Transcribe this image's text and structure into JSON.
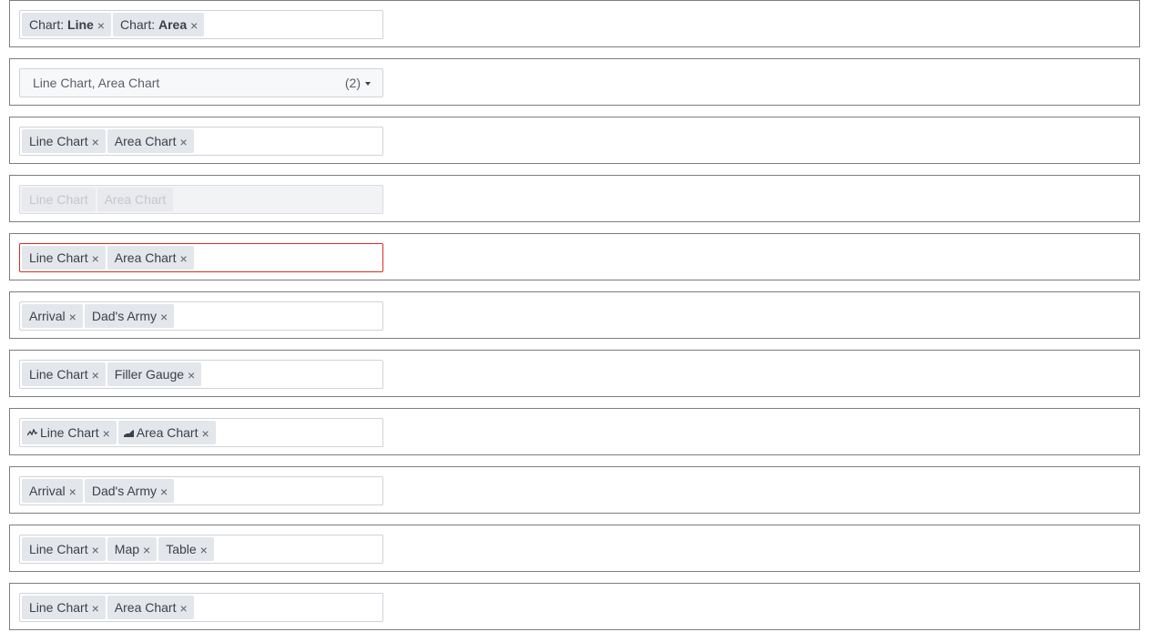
{
  "rows": [
    {
      "chips": [
        {
          "prefix": "Chart: ",
          "strong": "Line"
        },
        {
          "prefix": "Chart: ",
          "strong": "Area"
        }
      ]
    },
    {
      "dropdown": {
        "value": "Line Chart, Area Chart",
        "count": "(2)"
      }
    },
    {
      "chips": [
        "Line Chart",
        "Area Chart"
      ]
    },
    {
      "chips": [
        "Line Chart",
        "Area Chart"
      ],
      "state": "disabled"
    },
    {
      "chips": [
        "Line Chart",
        "Area Chart"
      ],
      "state": "error"
    },
    {
      "chips": [
        "Arrival",
        "Dad's Army"
      ]
    },
    {
      "chips": [
        "Line Chart",
        "Filler Gauge"
      ]
    },
    {
      "chips": [
        {
          "label": "Line Chart",
          "icon": "line-chart-icon"
        },
        {
          "label": "Area Chart",
          "icon": "area-chart-icon"
        }
      ]
    },
    {
      "chips": [
        "Arrival",
        "Dad's Army"
      ]
    },
    {
      "chips": [
        "Line Chart",
        "Map",
        "Table"
      ]
    },
    {
      "chips": [
        "Line Chart",
        "Area Chart"
      ]
    }
  ],
  "remove_glyph": "×",
  "colors": {
    "error_border": "#d5301f",
    "chip_bg": "#e3e6ea",
    "row_border": "#7d7d7d"
  }
}
